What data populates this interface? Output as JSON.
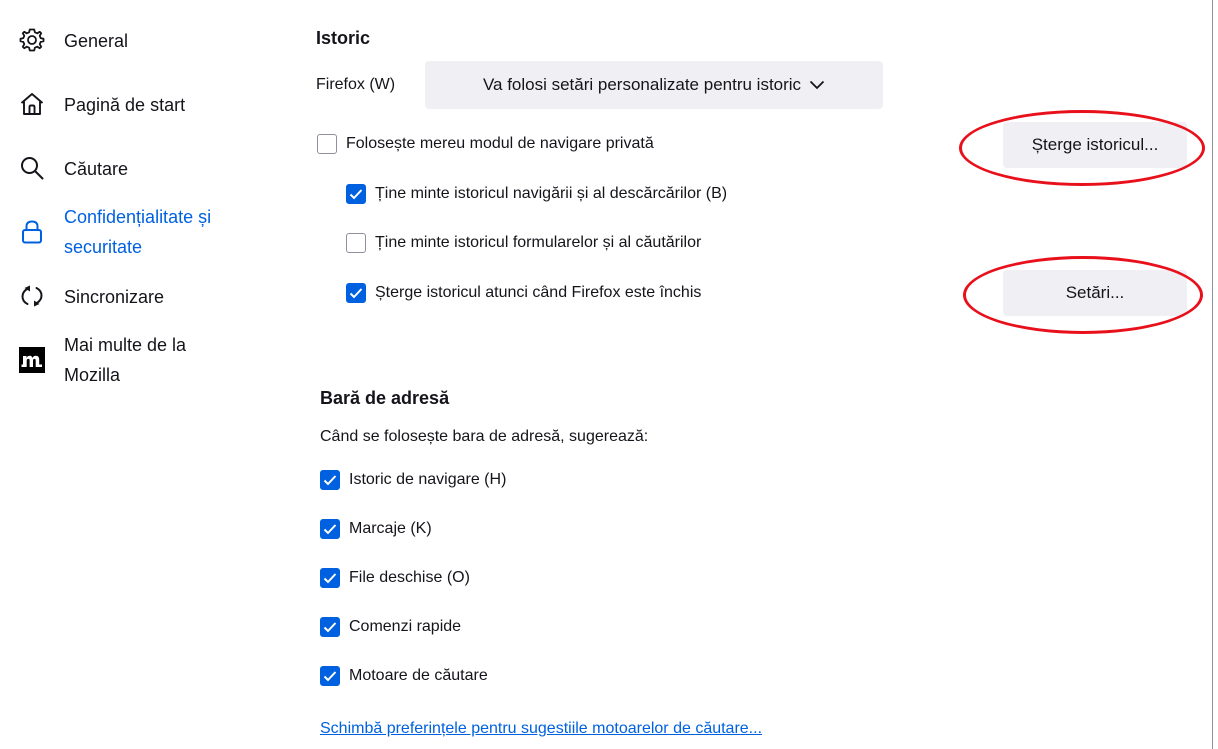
{
  "sidebar": {
    "items": [
      {
        "label": "General",
        "icon": "gear-icon"
      },
      {
        "label": "Pagină de start",
        "icon": "home-icon"
      },
      {
        "label": "Căutare",
        "icon": "search-icon"
      },
      {
        "label_line1": "Confidențialitate și",
        "label_line2": "securitate",
        "icon": "lock-icon",
        "active": true
      },
      {
        "label": "Sincronizare",
        "icon": "sync-icon"
      },
      {
        "label_line1": "Mai multe de la",
        "label_line2": "Mozilla",
        "icon": "mozilla-m-icon"
      }
    ]
  },
  "history": {
    "title": "Istoric",
    "firefox_label": "Firefox (W)",
    "dropdown_value": "Va folosi setări personalizate pentru istoric",
    "private_mode": {
      "label": "Folosește mereu modul de navigare privată",
      "checked": false
    },
    "remember_browsing": {
      "label": "Ține minte istoricul navigării și al descărcărilor (B)",
      "checked": true
    },
    "remember_forms": {
      "label": "Ține minte istoricul formularelor și al căutărilor",
      "checked": false
    },
    "clear_on_close": {
      "label": "Șterge istoricul atunci când Firefox este închis",
      "checked": true
    },
    "clear_history_button": "Șterge istoricul...",
    "settings_button": "Setări..."
  },
  "address_bar": {
    "title": "Bară de adresă",
    "subtitle": "Când se folosește bara de adresă, sugerează:",
    "options": [
      {
        "label": "Istoric de navigare (H)",
        "checked": true
      },
      {
        "label": "Marcaje (K)",
        "checked": true
      },
      {
        "label": "File deschise (O)",
        "checked": true
      },
      {
        "label": "Comenzi rapide",
        "checked": true
      },
      {
        "label": "Motoare de căutare",
        "checked": true
      }
    ],
    "change_prefs_link": "Schimbă preferințele pentru sugestiile motoarelor de căutare..."
  },
  "colors": {
    "accent": "#0061e0",
    "button_bg": "#f0f0f4",
    "annotation": "#e8101a"
  }
}
